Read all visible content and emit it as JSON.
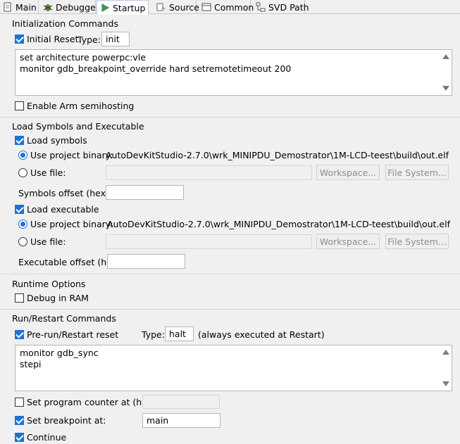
{
  "tabs": [
    {
      "label": "Main",
      "icon": "main-icon"
    },
    {
      "label": "Debugger",
      "icon": "bug-icon"
    },
    {
      "label": "Startup",
      "icon": "play-icon",
      "active": true
    },
    {
      "label": "Source",
      "icon": "source-icon"
    },
    {
      "label": "Common",
      "icon": "common-icon"
    },
    {
      "label": "SVD Path",
      "icon": "svd-icon"
    }
  ],
  "init": {
    "title": "Initialization Commands",
    "initial_reset_label": "Initial Reset.",
    "initial_reset_checked": true,
    "type_label": "Type:",
    "type_value": "init",
    "commands_line1": "set architecture powerpc:vle",
    "commands_line2": "monitor gdb_breakpoint_override hard setremotetimeout 200",
    "semihosting_label": "Enable Arm semihosting",
    "semihosting_checked": false
  },
  "load": {
    "title": "Load Symbols and Executable",
    "load_symbols_label": "Load symbols",
    "symbols_project_label": "Use project binary:",
    "symbols_project_path": "AutoDevKitStudio-2.7.0\\wrk_MINIPDU_Demostrator\\1M-LCD-teest\\build\\out.elf",
    "symbols_file_label": "Use file:",
    "symbols_file_value": "",
    "workspace_label": "Workspace...",
    "filesystem_label": "File System...",
    "symbols_offset_label": "Symbols offset (hex):",
    "symbols_offset_value": "",
    "load_exec_label": "Load executable",
    "exec_project_label": "Use project binary:",
    "exec_project_path": "AutoDevKitStudio-2.7.0\\wrk_MINIPDU_Demostrator\\1M-LCD-teest\\build\\out.elf",
    "exec_file_label": "Use file:",
    "exec_file_value": "",
    "exec_offset_label": "Executable offset (hex):",
    "exec_offset_value": ""
  },
  "runtime": {
    "title": "Runtime Options",
    "debug_ram_label": "Debug in RAM",
    "debug_ram_checked": false
  },
  "run": {
    "title": "Run/Restart Commands",
    "prerun_label": "Pre-run/Restart reset",
    "prerun_checked": true,
    "type_label": "Type:",
    "type_value": "halt",
    "type_note": "(always executed at Restart)",
    "commands_line1": "monitor gdb_sync",
    "commands_line2": "stepi",
    "pc_label": "Set program counter at (hex):",
    "pc_checked": false,
    "pc_value": "",
    "bp_label": "Set breakpoint at:",
    "bp_checked": true,
    "bp_value": "main",
    "continue_label": "Continue",
    "continue_checked": true
  }
}
